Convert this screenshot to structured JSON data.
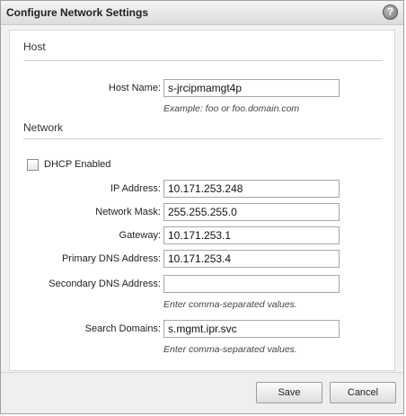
{
  "dialog": {
    "title": "Configure Network Settings",
    "help_icon": "?"
  },
  "host": {
    "section_title": "Host",
    "host_name_label": "Host Name:",
    "host_name_value": "s-jrcipmamgt4p",
    "host_name_hint": "Example: foo or foo.domain.com"
  },
  "network": {
    "section_title": "Network",
    "dhcp_label": "DHCP Enabled",
    "dhcp_checked": false,
    "ip_label": "IP Address:",
    "ip_value": "10.171.253.248",
    "mask_label": "Network Mask:",
    "mask_value": "255.255.255.0",
    "gateway_label": "Gateway:",
    "gateway_value": "10.171.253.1",
    "primary_dns_label": "Primary DNS Address:",
    "primary_dns_value": "10.171.253.4",
    "secondary_dns_label": "Secondary DNS Address:",
    "secondary_dns_value": "",
    "secondary_dns_hint": "Enter comma-separated values.",
    "search_domains_label": "Search Domains:",
    "search_domains_value": "s.mgmt.ipr.svc",
    "search_domains_hint": "Enter comma-separated values."
  },
  "footer": {
    "save_label": "Save",
    "cancel_label": "Cancel"
  }
}
